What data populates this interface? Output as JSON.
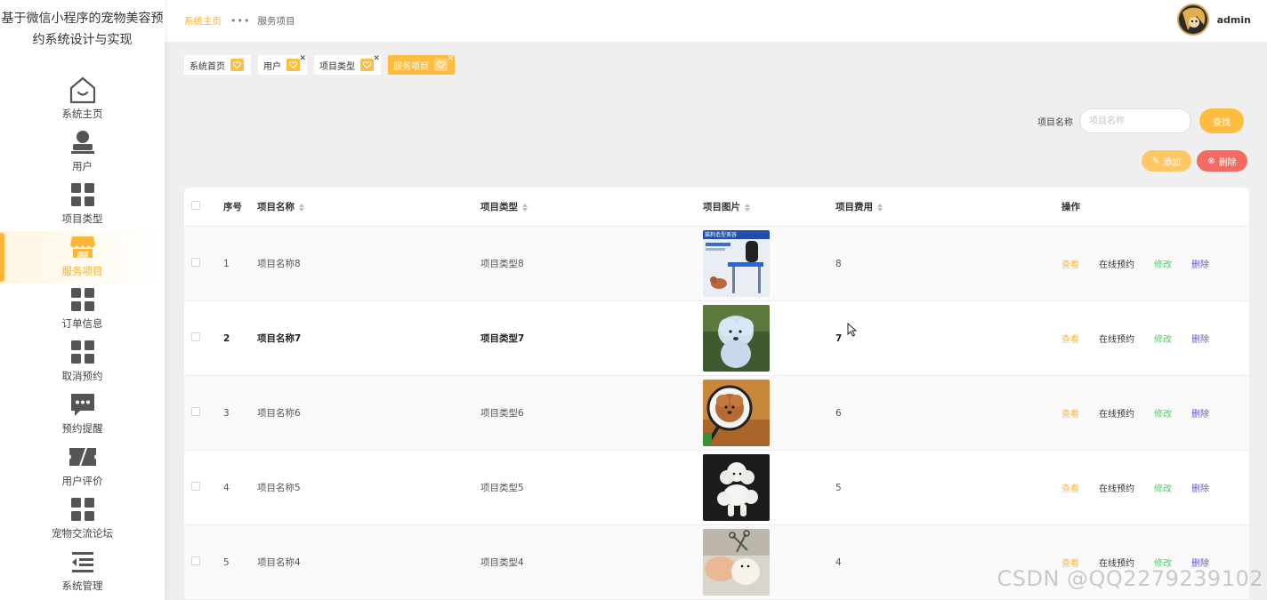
{
  "app": {
    "title": "基于微信小程序的宠物美容预约系统设计与实现"
  },
  "sidebar": {
    "items": [
      {
        "label": "系统主页",
        "icon": "home-icon"
      },
      {
        "label": "用户",
        "icon": "user-icon"
      },
      {
        "label": "项目类型",
        "icon": "grid-icon"
      },
      {
        "label": "服务项目",
        "icon": "shop-icon",
        "active": true
      },
      {
        "label": "订单信息",
        "icon": "grid-icon"
      },
      {
        "label": "取消预约",
        "icon": "grid-icon"
      },
      {
        "label": "预约提醒",
        "icon": "message-icon"
      },
      {
        "label": "用户评价",
        "icon": "ticket-icon"
      },
      {
        "label": "宠物交流论坛",
        "icon": "grid-icon"
      },
      {
        "label": "系统管理",
        "icon": "menu-icon"
      }
    ]
  },
  "breadcrumb": {
    "first": "系统主页",
    "second": "服务项目"
  },
  "user": {
    "name": "admin"
  },
  "tags": [
    {
      "label": "系统首页"
    },
    {
      "label": "用户",
      "closable": true
    },
    {
      "label": "项目类型",
      "closable": true
    },
    {
      "label": "服务项目",
      "closable": true,
      "active": true
    }
  ],
  "search": {
    "label": "项目名称",
    "placeholder": "项目名称",
    "button": "查找"
  },
  "actions": {
    "add": "添加",
    "delete": "删除"
  },
  "table": {
    "headers": {
      "no": "序号",
      "name": "项目名称",
      "type": "项目类型",
      "image": "项目图片",
      "fee": "项目费用",
      "ops": "操作"
    },
    "ops": {
      "view": "查看",
      "book": "在线预约",
      "edit": "修改",
      "delete": "删除"
    },
    "rows": [
      {
        "no": "1",
        "name": "项目名称8",
        "type": "项目类型8",
        "fee": "8",
        "poster_text": "猫狗造型美容"
      },
      {
        "no": "2",
        "name": "项目名称7",
        "type": "项目类型7",
        "fee": "7"
      },
      {
        "no": "3",
        "name": "项目名称6",
        "type": "项目类型6",
        "fee": "6"
      },
      {
        "no": "4",
        "name": "项目名称5",
        "type": "项目类型5",
        "fee": "5"
      },
      {
        "no": "5",
        "name": "项目名称4",
        "type": "项目类型4",
        "fee": "4"
      }
    ]
  },
  "watermark": "CSDN @QQ2279239102",
  "colors": {
    "accent": "#ffbd3f",
    "danger": "#f46c61",
    "edit": "#5cc36a",
    "delete_link": "#6a54c8"
  }
}
